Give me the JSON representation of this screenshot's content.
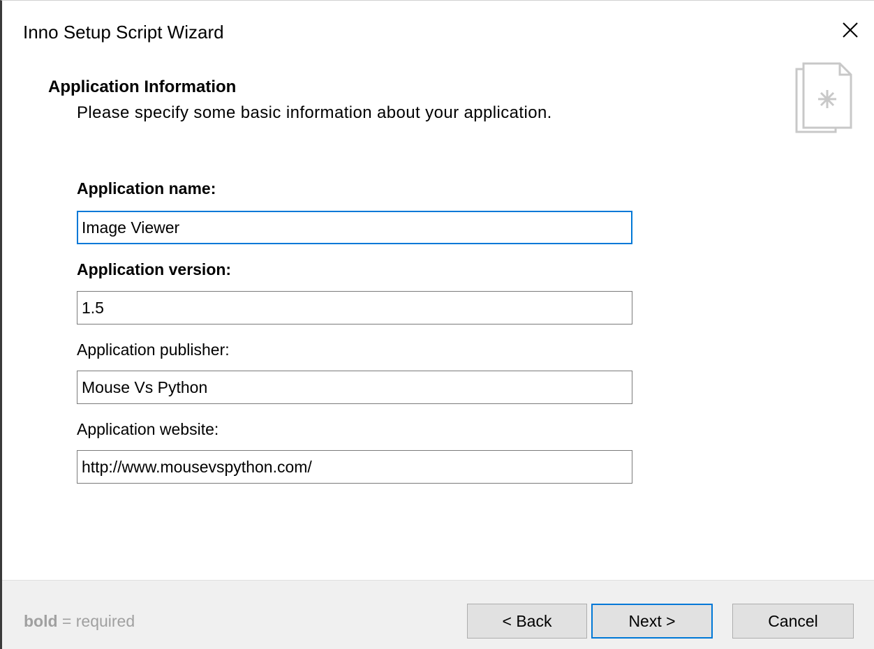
{
  "window": {
    "title": "Inno Setup Script Wizard",
    "close_icon": "close-icon"
  },
  "header": {
    "title": "Application Information",
    "subtitle": "Please specify some basic information about your application.",
    "icon": "wizard-document-icon"
  },
  "form": {
    "app_name": {
      "label": "Application name:",
      "value": "Image Viewer",
      "required": true,
      "focused": true
    },
    "app_version": {
      "label": "Application version:",
      "value": "1.5",
      "required": true
    },
    "app_publisher": {
      "label": "Application publisher:",
      "value": "Mouse Vs Python",
      "required": false
    },
    "app_website": {
      "label": "Application website:",
      "value": "http://www.mousevspython.com/",
      "required": false
    }
  },
  "footer": {
    "hint_bold": "bold",
    "hint_rest": " = required",
    "back_label": "< Back",
    "next_label": "Next >",
    "cancel_label": "Cancel"
  },
  "colors": {
    "focus_accent": "#0078d7",
    "footer_bg": "#f0f0f0",
    "button_bg": "#e1e1e1",
    "hint_text": "#a0a0a0"
  }
}
